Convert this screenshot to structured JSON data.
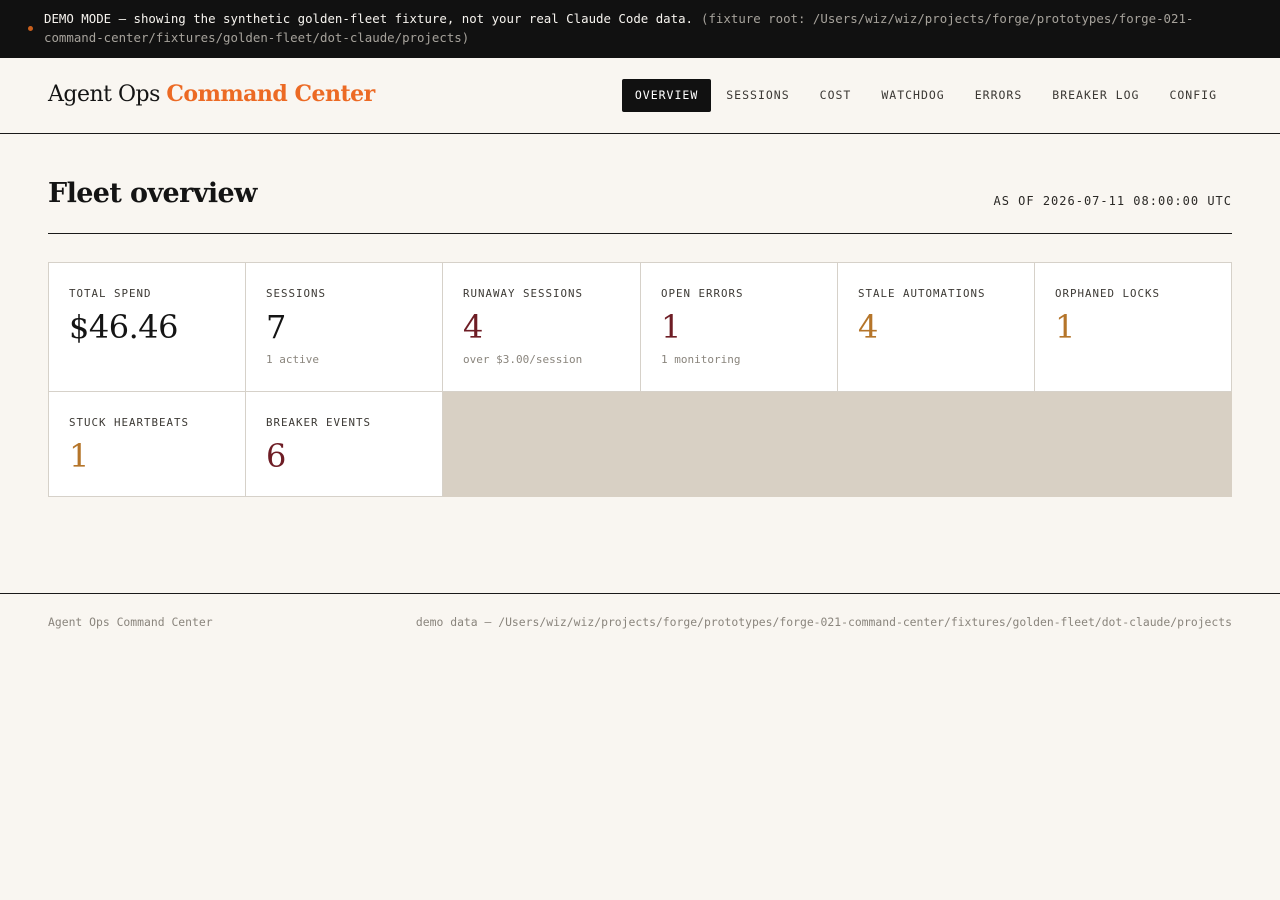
{
  "banner": {
    "icon": "status-dot",
    "message": "DEMO MODE — showing the synthetic golden-fleet fixture, not your real Claude Code data.",
    "fixture_root": "(fixture root: /Users/wiz/wiz/projects/forge/prototypes/forge-021-command-center/fixtures/golden-fleet/dot-claude/projects)"
  },
  "brand": {
    "part1": "Agent Ops",
    "part2": "Command Center"
  },
  "nav": {
    "items": [
      {
        "label": "OVERVIEW",
        "active": true
      },
      {
        "label": "SESSIONS"
      },
      {
        "label": "COST"
      },
      {
        "label": "WATCHDOG"
      },
      {
        "label": "ERRORS"
      },
      {
        "label": "BREAKER LOG"
      },
      {
        "label": "CONFIG"
      }
    ]
  },
  "page": {
    "title": "Fleet overview",
    "as_of": "AS OF 2026-07-11 08:00:00 UTC"
  },
  "cards": [
    {
      "label": "TOTAL SPEND",
      "value": "$46.46",
      "sub": ""
    },
    {
      "label": "SESSIONS",
      "value": "7",
      "sub": "1 active"
    },
    {
      "label": "RUNAWAY SESSIONS",
      "value": "4",
      "sub": "over $3.00/session"
    },
    {
      "label": "OPEN ERRORS",
      "value": "1",
      "sub": "1 monitoring"
    },
    {
      "label": "STALE AUTOMATIONS",
      "value": "4",
      "sub": ""
    },
    {
      "label": "ORPHANED LOCKS",
      "value": "1",
      "sub": ""
    },
    {
      "label": "STUCK HEARTBEATS",
      "value": "1",
      "sub": ""
    },
    {
      "label": "BREAKER EVENTS",
      "value": "6",
      "sub": ""
    }
  ],
  "footer": {
    "left": "Agent Ops Command Center",
    "right": "demo data — /Users/wiz/wiz/projects/forge/prototypes/forge-021-command-center/fixtures/golden-fleet/dot-claude/projects"
  },
  "colors": {
    "accent": "#ec6a24",
    "critical": "#6e1d25",
    "warning": "#b5752a",
    "background": "#f9f6f1"
  }
}
